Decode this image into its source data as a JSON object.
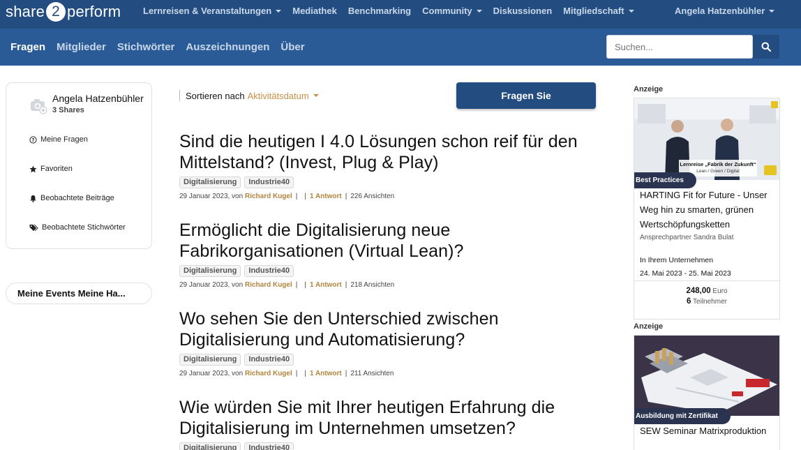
{
  "brand": {
    "pre": "share",
    "mid": "2",
    "post": "perform"
  },
  "topnav": {
    "items": [
      {
        "label": "Lernreisen & Veranstaltungen",
        "dropdown": true
      },
      {
        "label": "Mediathek",
        "dropdown": false
      },
      {
        "label": "Benchmarking",
        "dropdown": false
      },
      {
        "label": "Community",
        "dropdown": true
      },
      {
        "label": "Diskussionen",
        "dropdown": false
      },
      {
        "label": "Mitgliedschaft",
        "dropdown": true
      }
    ],
    "user": "Angela Hatzenbühler"
  },
  "subnav": {
    "tabs": [
      "Fragen",
      "Mitglieder",
      "Stichwörter",
      "Auszeichnungen",
      "Über"
    ],
    "active": "Fragen"
  },
  "search": {
    "placeholder": "Suchen...",
    "icon": "search-icon"
  },
  "profile": {
    "name": "Angela Hatzenbühler",
    "shares": "3 Shares",
    "links": [
      {
        "label": "Meine Fragen",
        "icon": "question-circle-icon"
      },
      {
        "label": "Favoriten",
        "icon": "star-icon"
      },
      {
        "label": "Beobachtete Beiträge",
        "icon": "bell-icon"
      },
      {
        "label": "Beobachtete Stichwörter",
        "icon": "tags-icon"
      }
    ]
  },
  "events_box": "Meine Events Meine Ha...",
  "sort": {
    "prefix": "Sortieren nach",
    "value": "Aktivitätsdatum"
  },
  "ask_button": "Fragen Sie",
  "questions": [
    {
      "title": "Sind die heutigen I 4.0 Lösungen schon reif für den Mittelstand? (Invest, Plug & Play)",
      "tags": [
        "Digitalisierung",
        "Industrie40"
      ],
      "date": "29 Januar 2023, von",
      "author": "Richard Kugel",
      "answers": "1 Antwort",
      "views": "226 Ansichten"
    },
    {
      "title": "Ermöglicht die Digitalisierung neue Fabrikorganisationen (Virtual Lean)?",
      "tags": [
        "Digitalisierung",
        "Industrie40"
      ],
      "date": "29 Januar 2023, von",
      "author": "Richard Kugel",
      "answers": "1 Antwort",
      "views": "218 Ansichten"
    },
    {
      "title": "Wo sehen Sie den Unterschied zwischen Digitalisierung und Automatisierung?",
      "tags": [
        "Digitalisierung",
        "Industrie40"
      ],
      "date": "29 Januar 2023, von",
      "author": "Richard Kugel",
      "answers": "1 Antwort",
      "views": "211 Ansichten"
    },
    {
      "title": "Wie würden Sie mit Ihrer heutigen Erfahrung die Digitalisierung im Unternehmen umsetzen?",
      "tags": [
        "Digitalisierung",
        "Industrie40"
      ]
    }
  ],
  "ads": [
    {
      "label": "Anzeige",
      "badge": "Best Practices",
      "image_caption_line1": "Lernreise „Fabrik der Zukunft“",
      "image_caption_line2": "Lean / Green / Digital",
      "title": "HARTING Fit for Future - Unser Weg hin zu smarten, grünen Wertschöpfungsketten",
      "contact": "Ansprechpartner Sandra Bulat",
      "location": "In Ihrem Unternehmen",
      "dates": "24. Mai 2023 - 25. Mai 2023",
      "price_value": "248,00",
      "price_unit": "Euro",
      "participants_value": "6",
      "participants_unit": "Teilnehmer"
    },
    {
      "label": "Anzeige",
      "badge": "Ausbildung mit Zertifikat",
      "title": "SEW Seminar Matrixproduktion"
    }
  ],
  "colors": {
    "nav_dark": "#234d80",
    "nav_sub": "#2a5b96",
    "accent_gold": "#c79046"
  }
}
